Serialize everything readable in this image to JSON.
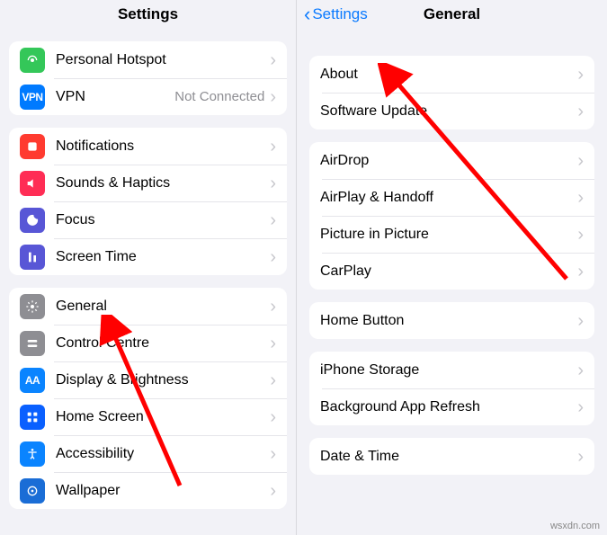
{
  "left": {
    "title": "Settings",
    "groups": [
      {
        "rows": [
          {
            "id": "personal-hotspot",
            "label": "Personal Hotspot",
            "icon": "hotspot-icon",
            "iconClass": "bg-green",
            "status": ""
          },
          {
            "id": "vpn",
            "label": "VPN",
            "icon": "vpn-icon",
            "iconClass": "bg-blue",
            "status": "Not Connected",
            "iconText": "VPN"
          }
        ]
      },
      {
        "rows": [
          {
            "id": "notifications",
            "label": "Notifications",
            "icon": "notifications-icon",
            "iconClass": "bg-red"
          },
          {
            "id": "sounds",
            "label": "Sounds & Haptics",
            "icon": "sounds-icon",
            "iconClass": "bg-pink"
          },
          {
            "id": "focus",
            "label": "Focus",
            "icon": "focus-icon",
            "iconClass": "bg-indigo"
          },
          {
            "id": "screen-time",
            "label": "Screen Time",
            "icon": "screentime-icon",
            "iconClass": "bg-indigo"
          }
        ]
      },
      {
        "rows": [
          {
            "id": "general",
            "label": "General",
            "icon": "general-icon",
            "iconClass": "bg-gray"
          },
          {
            "id": "control-centre",
            "label": "Control Centre",
            "icon": "control-centre-icon",
            "iconClass": "bg-gray"
          },
          {
            "id": "display",
            "label": "Display & Brightness",
            "icon": "display-icon",
            "iconClass": "bg-blue2",
            "iconText": "AA"
          },
          {
            "id": "home-screen",
            "label": "Home Screen",
            "icon": "home-screen-icon",
            "iconClass": "bg-blue3"
          },
          {
            "id": "accessibility",
            "label": "Accessibility",
            "icon": "accessibility-icon",
            "iconClass": "bg-blue2"
          },
          {
            "id": "wallpaper",
            "label": "Wallpaper",
            "icon": "wallpaper-icon",
            "iconClass": "bg-cobalt"
          }
        ]
      }
    ]
  },
  "right": {
    "back": "Settings",
    "title": "General",
    "groups": [
      {
        "rows": [
          {
            "id": "about",
            "label": "About"
          },
          {
            "id": "software-update",
            "label": "Software Update"
          }
        ]
      },
      {
        "rows": [
          {
            "id": "airdrop",
            "label": "AirDrop"
          },
          {
            "id": "airplay",
            "label": "AirPlay & Handoff"
          },
          {
            "id": "pip",
            "label": "Picture in Picture"
          },
          {
            "id": "carplay",
            "label": "CarPlay"
          }
        ]
      },
      {
        "rows": [
          {
            "id": "home-button",
            "label": "Home Button"
          }
        ]
      },
      {
        "rows": [
          {
            "id": "iphone-storage",
            "label": "iPhone Storage"
          },
          {
            "id": "background-refresh",
            "label": "Background App Refresh"
          }
        ]
      },
      {
        "rows": [
          {
            "id": "date-time",
            "label": "Date & Time"
          }
        ]
      }
    ]
  },
  "watermark": "wsxdn.com"
}
